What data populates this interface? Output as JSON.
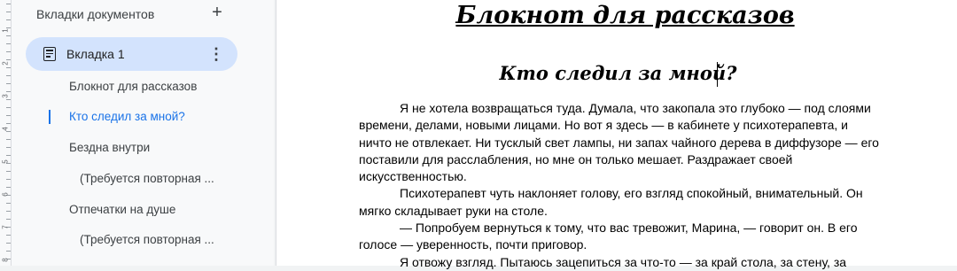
{
  "sidebar": {
    "header": "Вкладки документов",
    "add_icon": "plus-icon",
    "active_tab": {
      "label": "Вкладка 1",
      "icon": "document-icon",
      "menu_icon": "more-vert-icon"
    },
    "outline": [
      {
        "label": "Блокнот для рассказов",
        "level": 1,
        "current": false
      },
      {
        "label": "Кто следил за мной?",
        "level": 1,
        "current": true
      },
      {
        "label": "Бездна внутри",
        "level": 1,
        "current": false
      },
      {
        "label": "(Требуется повторная ...",
        "level": 2,
        "current": false
      },
      {
        "label": "Отпечатки на душе",
        "level": 1,
        "current": false
      },
      {
        "label": "(Требуется повторная ...",
        "level": 2,
        "current": false
      }
    ]
  },
  "ruler": {
    "numbers": [
      "1",
      "2",
      "3",
      "4",
      "5",
      "6",
      "7",
      "8"
    ]
  },
  "document": {
    "title": "Блокнот для рассказов",
    "subtitle": "Кто следил за мной?",
    "paragraphs": [
      "Я не хотела возвращаться туда. Думала, что закопала это глубоко — под слоями времени, делами, новыми лицами. Но вот я здесь — в кабинете у психотерапевта, и ничто не отвлекает. Ни тусклый свет лампы, ни запах чайного дерева в диффузоре — его поставили для расслабления, но мне он только мешает. Раздражает своей искусственностью.",
      "Психотерапевт чуть наклоняет голову, его взгляд спокойный, внимательный. Он мягко складывает руки на столе.",
      "— Попробуем вернуться к тому, что вас тревожит, Марина, — говорит он. В его голосе — уверенность, почти приговор.",
      "Я отвожу взгляд. Пытаюсь зацепиться за что-то — за край стола, за стену, за"
    ]
  },
  "colors": {
    "active_tab_bg": "#d3e3fd",
    "current_item": "#1a73e8",
    "sidebar_bg": "#f8f9fa"
  }
}
